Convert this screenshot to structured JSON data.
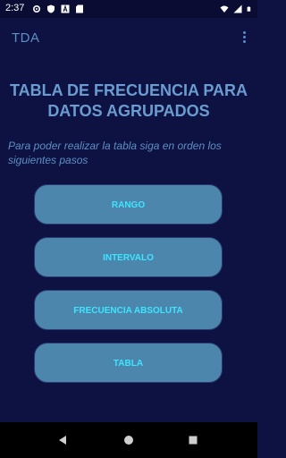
{
  "status_bar": {
    "time": "2:37",
    "icons": [
      "settings-icon",
      "shield-icon",
      "font-icon",
      "sd-card-icon",
      "wifi-icon",
      "signal-icon",
      "battery-icon"
    ]
  },
  "app_bar": {
    "title": "TDA",
    "menu_icon": "more-vert-icon"
  },
  "heading": {
    "line1": "TABLA DE FRECUENCIA PARA",
    "line2": "DATOS AGRUPADOS"
  },
  "instructions": "Para poder realizar la tabla siga en orden los siguientes pasos",
  "buttons": [
    {
      "label": "RANGO"
    },
    {
      "label": "INTERVALO"
    },
    {
      "label": "FRECUENCIA ABSOLUTA"
    },
    {
      "label": "TABLA"
    }
  ],
  "nav_bar": {
    "icons": [
      "back-icon",
      "home-icon",
      "recents-icon"
    ]
  },
  "colors": {
    "background": "#0d1242",
    "title_text": "#5c8fc4",
    "heading_text": "#6a9cd0",
    "button_bg": "#4c86ad",
    "button_text": "#3fe4ff"
  }
}
